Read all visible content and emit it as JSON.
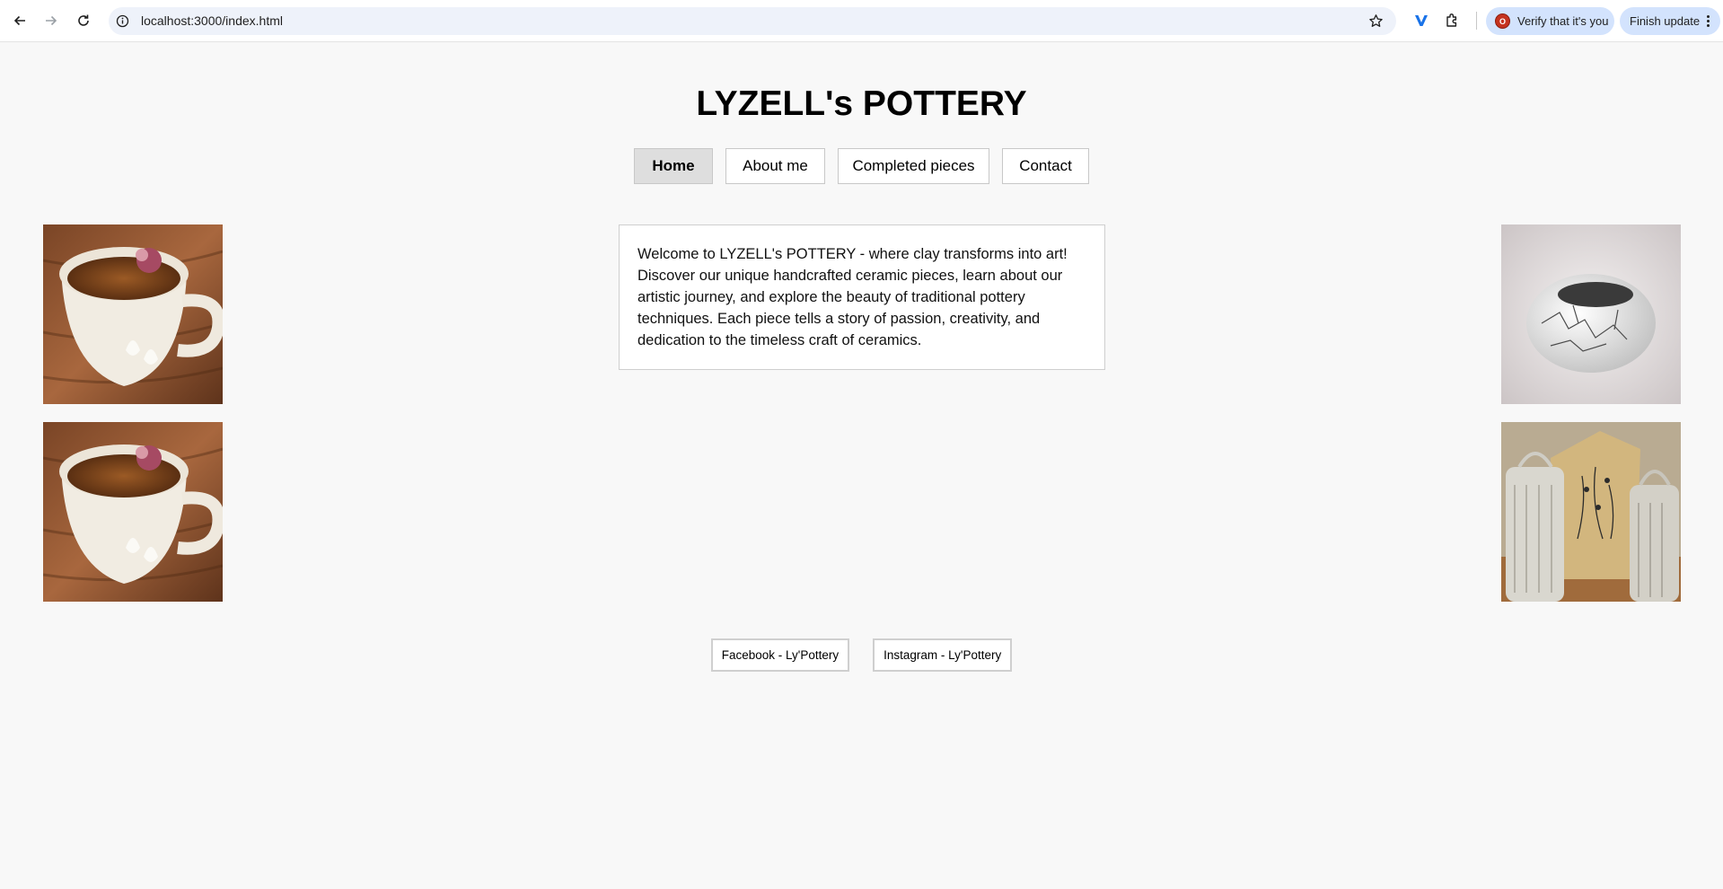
{
  "browser": {
    "url": "localhost:3000/index.html",
    "verify_label": "Verify that it's you",
    "update_label": "Finish update",
    "avatar_letter": "O"
  },
  "site": {
    "title": "LYZELL's POTTERY",
    "nav": [
      {
        "label": "Home",
        "active": true
      },
      {
        "label": "About me",
        "active": false
      },
      {
        "label": "Completed pieces",
        "active": false
      },
      {
        "label": "Contact",
        "active": false
      }
    ],
    "intro": "Welcome to LYZELL's POTTERY - where clay transforms into art! Discover our unique handcrafted ceramic pieces, learn about our artistic journey, and explore the beauty of traditional pottery techniques. Each piece tells a story of passion, creativity, and dedication to the timeless craft of ceramics.",
    "social": [
      {
        "label": "Facebook - Ly'Pottery"
      },
      {
        "label": "Instagram - Ly'Pottery"
      }
    ]
  },
  "images": [
    {
      "name": "teacup-photo",
      "subject": "white ceramic teacup with tea"
    },
    {
      "name": "teacup-photo",
      "subject": "white ceramic teacup with tea"
    },
    {
      "name": "raku-bowl-photo",
      "subject": "white raku bowl with crackle glaze"
    },
    {
      "name": "jars-vase-photo",
      "subject": "lidded ceramic jars and vase"
    }
  ],
  "colors": {
    "page_bg": "#f8f8f8",
    "active_nav_bg": "#dedede",
    "pill_bg": "#d3e3fd",
    "omnibox_bg": "#eef2fa"
  }
}
